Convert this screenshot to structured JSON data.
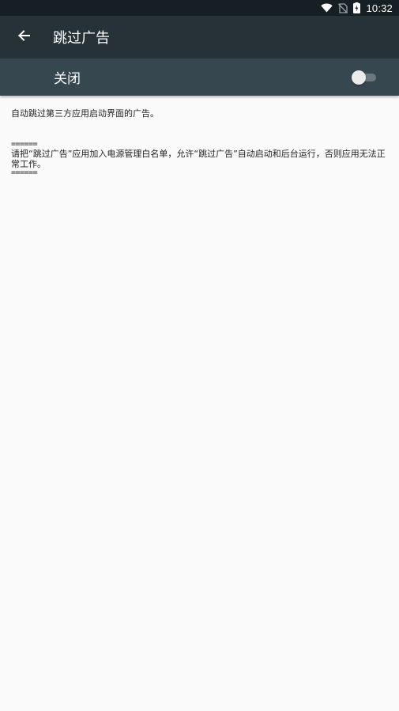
{
  "status_bar": {
    "time": "10:32",
    "icons": [
      "wifi-icon",
      "no-sim-icon",
      "battery-charging-icon"
    ]
  },
  "toolbar": {
    "back_icon": "arrow-back-icon",
    "title": "跳过广告"
  },
  "switch_bar": {
    "label": "关闭",
    "toggle_state": "off"
  },
  "content": {
    "description": "自动跳过第三方应用启动界面的广告。",
    "notice_separator_top": "======",
    "notice_text": "请把“跳过广告”应用加入电源管理白名单，允许“跳过广告”自动启动和后台运行，否则应用无法正常工作。",
    "notice_separator_bottom": "======"
  },
  "colors": {
    "status_bar": "#162024",
    "toolbar": "#263238",
    "switch_bar": "#37474f",
    "background": "#fafafa"
  }
}
